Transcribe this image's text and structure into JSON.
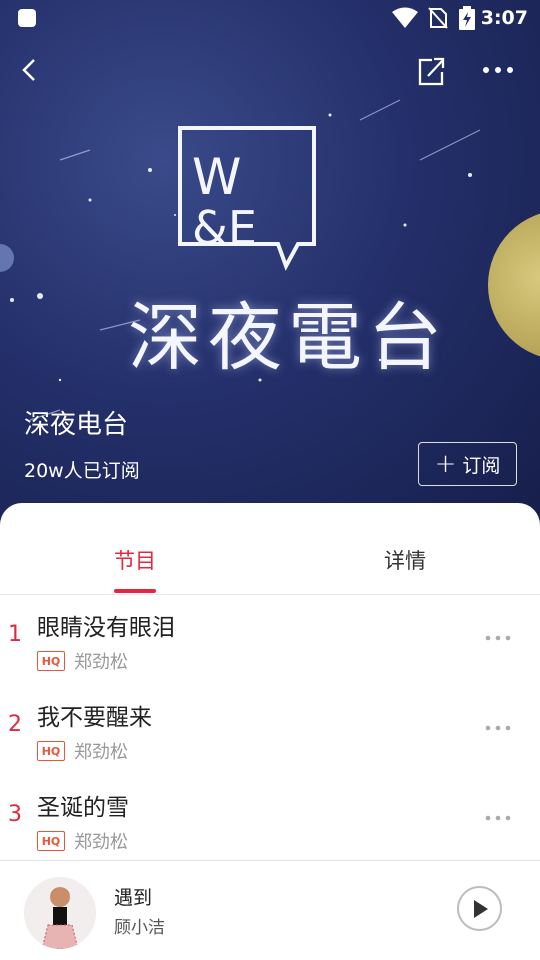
{
  "status_bar": {
    "time": "3:07"
  },
  "cover": {
    "logo_text_line1": "W",
    "logo_text_line2": "&E",
    "title": "深夜電台"
  },
  "radio": {
    "name": "深夜电台",
    "subscribers": "20w人已订阅",
    "subscribe_label": "订阅"
  },
  "tabs": [
    {
      "label": "节目",
      "active": true
    },
    {
      "label": "详情",
      "active": false
    }
  ],
  "tracks": [
    {
      "index": "1",
      "title": "眼睛没有眼泪",
      "quality": "HQ",
      "artist": "郑劲松"
    },
    {
      "index": "2",
      "title": "我不要醒来",
      "quality": "HQ",
      "artist": "郑劲松"
    },
    {
      "index": "3",
      "title": "圣诞的雪",
      "quality": "HQ",
      "artist": "郑劲松"
    }
  ],
  "now_playing": {
    "song": "遇到",
    "singer": "顾小洁"
  },
  "colors": {
    "accent": "#e0283f",
    "hero_bg": "#24306b"
  }
}
